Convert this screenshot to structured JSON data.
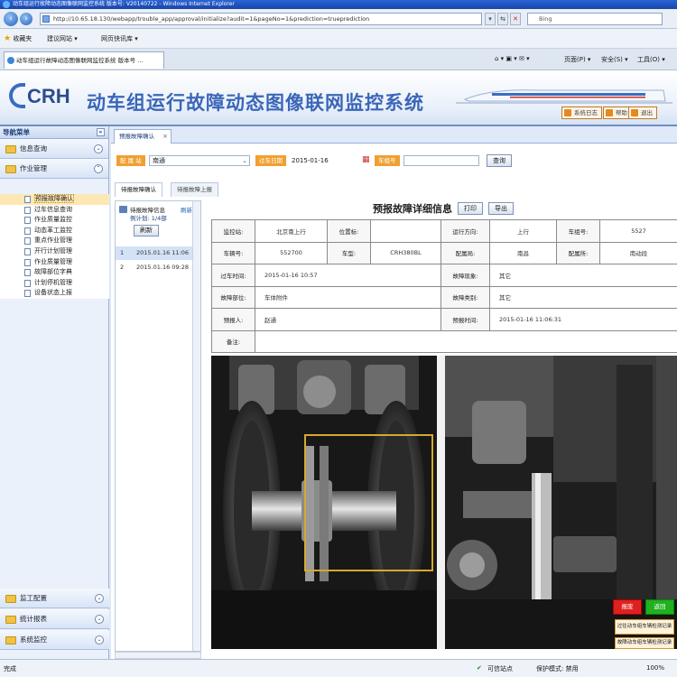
{
  "browser": {
    "title": "动车组运行故障动态图像联网监控系统 版本号: V20140722 - Windows Internet Explorer",
    "address": "http://10.65.18.130/webapp/trouble_app/approval/initialize?audit=1&pageNo=1&prediction=trueprediction",
    "search_placeholder": "Bing",
    "favorites_label": "收藏夹",
    "fav_links": [
      "建议网站 ▾",
      "网页快讯库 ▾"
    ],
    "tab_title": "动车组运行故障动态图像联网监控系统 版本号 ...",
    "commands": [
      "页面(P) ▾",
      "安全(S) ▾",
      "工具(O) ▾"
    ]
  },
  "header": {
    "logo": "CRH",
    "system_title": "动车组运行故障动态图像联网监控系统",
    "links": [
      "系统日志",
      "帮助",
      "退出"
    ]
  },
  "sidebar": {
    "title": "导航菜单",
    "groups_top": [
      {
        "label": "信息查询"
      },
      {
        "label": "作业管理"
      }
    ],
    "items": [
      {
        "label": "预报故障确认",
        "active": true
      },
      {
        "label": "过车信息查询",
        "active": false
      },
      {
        "label": "作业质量监控",
        "active": false
      },
      {
        "label": "动态革工监控",
        "active": false
      },
      {
        "label": "重点作业管理",
        "active": false
      },
      {
        "label": "开行计划管理",
        "active": false
      },
      {
        "label": "作业质量管理",
        "active": false
      },
      {
        "label": "故障部位字典",
        "active": false
      },
      {
        "label": "计划停机管理",
        "active": false
      },
      {
        "label": "设备状态上报",
        "active": false
      }
    ],
    "groups_bottom": [
      {
        "label": "监工配置"
      },
      {
        "label": "统计报表"
      },
      {
        "label": "系统监控"
      }
    ]
  },
  "content": {
    "tab_label": "预报故障确认",
    "filter": {
      "station_label": "配 属 站",
      "station_value": "南通",
      "date_label": "过车日期",
      "date_value": "2015-01-16",
      "train_label": "车组号",
      "train_value": "",
      "query_button": "查询"
    },
    "subtabs": [
      "待报故障确认",
      "待报故障上报"
    ],
    "list": {
      "header_text": "待报故障信息",
      "header_link": "刷新",
      "plan_text": "例计划: 1/4部",
      "refresh_button": "刷新",
      "rows": [
        {
          "num": "1",
          "time": "2015.01.16 11:06"
        },
        {
          "num": "2",
          "time": "2015.01.16 09:28"
        }
      ]
    },
    "detail": {
      "title": "预报故障详细信息",
      "print_button": "打印",
      "export_button": "导出",
      "rows": [
        [
          {
            "k": "监控站:",
            "v": "北京南上行"
          },
          {
            "k": "位置标:",
            "v": ""
          },
          {
            "k": "运行方向:",
            "v": "上行"
          },
          {
            "k": "车组号:",
            "v": "5527"
          }
        ],
        [
          {
            "k": "车辆号:",
            "v": "552700"
          },
          {
            "k": "车型:",
            "v": "CRH380BL"
          },
          {
            "k": "配属局:",
            "v": "南昌"
          },
          {
            "k": "配属所:",
            "v": "南动段"
          }
        ],
        [
          {
            "k": "过车时间:",
            "v": "2015-01-16 10:57"
          },
          {
            "k": "故障现象:",
            "v": "其它"
          }
        ],
        [
          {
            "k": "故障部位:",
            "v": "车体附件"
          },
          {
            "k": "故障类别:",
            "v": "其它"
          }
        ],
        [
          {
            "k": "预报人:",
            "v": "赵通"
          },
          {
            "k": "预报时间:",
            "v": "2015-01-16 11:06:31"
          }
        ],
        [
          {
            "k": "备注:",
            "v": ""
          }
        ]
      ]
    },
    "image_buttons": {
      "red": "报废",
      "green": "返回",
      "btn1": "过往动车组车辆检测记录",
      "btn2": "故障动车组车辆检测记录"
    }
  },
  "statusbar": {
    "left": "完成",
    "zone": "可信站点",
    "protected": "保护模式: 禁用",
    "zoom": "100%"
  }
}
